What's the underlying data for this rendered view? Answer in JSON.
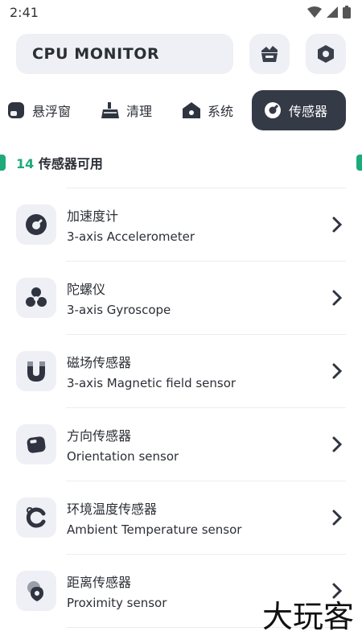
{
  "status_bar": {
    "time": "2:41"
  },
  "header": {
    "title": "CPU MONITOR",
    "left_button_icon": "broom-icon",
    "right_button_icon": "settings-hex-icon"
  },
  "tabs": [
    {
      "label": "悬浮窗",
      "icon": "floating-window-icon",
      "active": false
    },
    {
      "label": "清理",
      "icon": "broom-icon",
      "active": false
    },
    {
      "label": "系统",
      "icon": "house-icon",
      "active": false
    },
    {
      "label": "传感器",
      "icon": "sensor-icon",
      "active": true
    }
  ],
  "sensor_count": {
    "number": "14",
    "label": " 传感器可用"
  },
  "sensors": [
    {
      "name": "加速度计",
      "desc": "3-axis Accelerometer",
      "icon": "accelerometer-icon"
    },
    {
      "name": "陀螺仪",
      "desc": "3-axis Gyroscope",
      "icon": "gyroscope-icon"
    },
    {
      "name": "磁场传感器",
      "desc": "3-axis Magnetic field sensor",
      "icon": "magnet-icon"
    },
    {
      "name": "方向传感器",
      "desc": "Orientation sensor",
      "icon": "orientation-icon"
    },
    {
      "name": "环境温度传感器",
      "desc": "Ambient Temperature sensor",
      "icon": "temperature-icon"
    },
    {
      "name": "距离传感器",
      "desc": "Proximity sensor",
      "icon": "proximity-icon"
    }
  ],
  "watermark": "大玩客",
  "colors": {
    "accent": "#1faa7a",
    "active_tab": "#353a47",
    "card_bg": "#eef0f5"
  }
}
